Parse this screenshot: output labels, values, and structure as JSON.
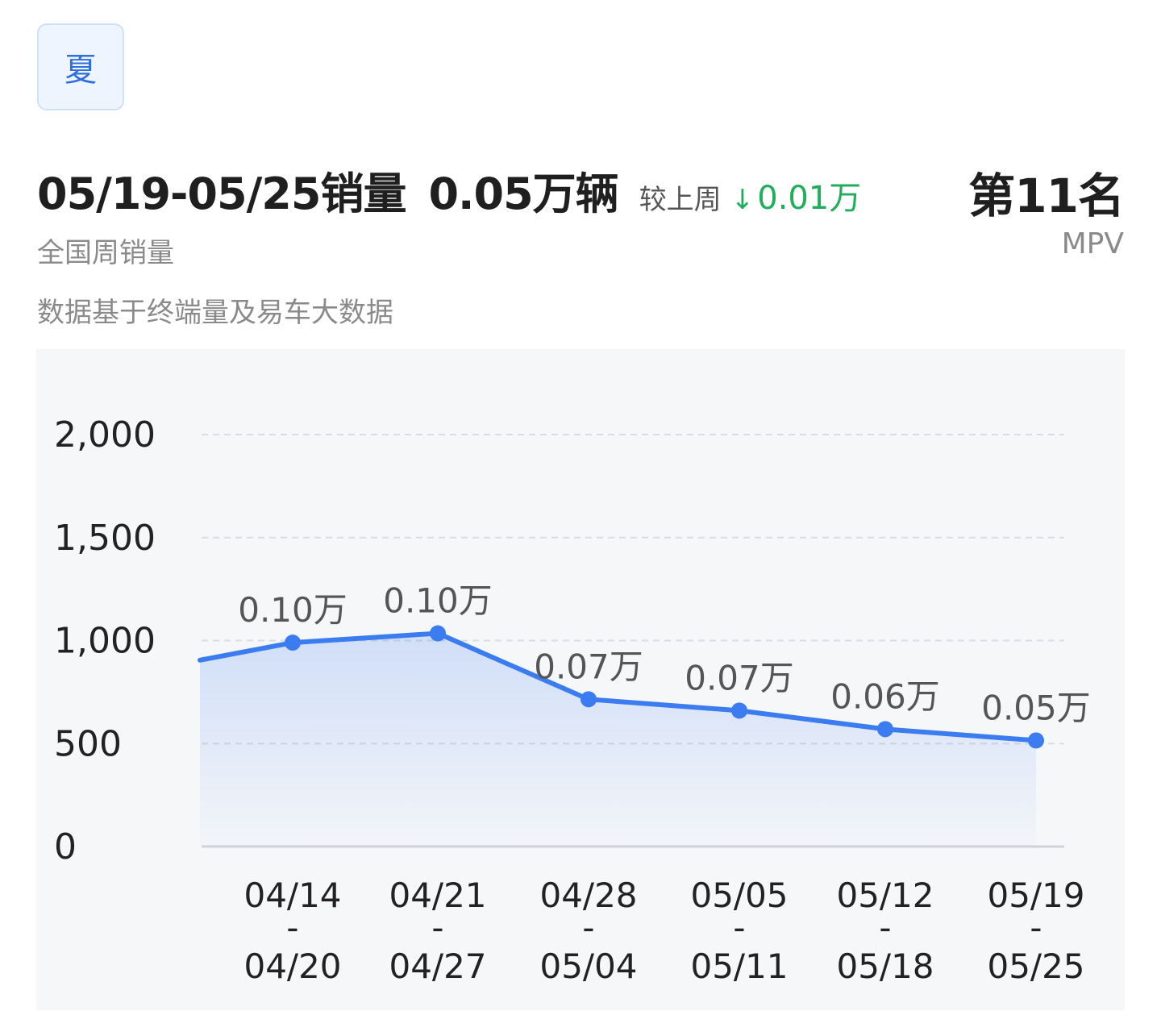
{
  "badge": {
    "label": "夏"
  },
  "summary": {
    "range": "05/19-05/25销量",
    "value": "0.05万辆",
    "compare_label": "较上周",
    "delta": "0.01万",
    "rank": "第11名",
    "subtitle": "全国周销量",
    "category": "MPV",
    "source_note": "数据基于终端量及易车大数据"
  },
  "colors": {
    "accent": "#3b7cf0",
    "down": "#1fae5b",
    "card_bg": "#f6f7f9"
  },
  "icons": {
    "delta_arrow": "arrow-down-icon"
  },
  "chart_data": {
    "type": "line",
    "y_ticks": [
      "2,000",
      "1,500",
      "1,000",
      "500",
      "0"
    ],
    "ylim": [
      0,
      2000
    ],
    "grid": true,
    "categories": [
      {
        "top": "04/14",
        "sep": "-",
        "bottom": "04/20"
      },
      {
        "top": "04/21",
        "sep": "-",
        "bottom": "04/27"
      },
      {
        "top": "04/28",
        "sep": "-",
        "bottom": "05/04"
      },
      {
        "top": "05/05",
        "sep": "-",
        "bottom": "05/11"
      },
      {
        "top": "05/12",
        "sep": "-",
        "bottom": "05/18"
      },
      {
        "top": "05/19",
        "sep": "-",
        "bottom": "05/25"
      }
    ],
    "values": [
      990,
      1035,
      715,
      660,
      570,
      515
    ],
    "labels": [
      "0.10万",
      "0.10万",
      "0.07万",
      "0.07万",
      "0.06万",
      "0.05万"
    ],
    "prev_value": 905
  }
}
